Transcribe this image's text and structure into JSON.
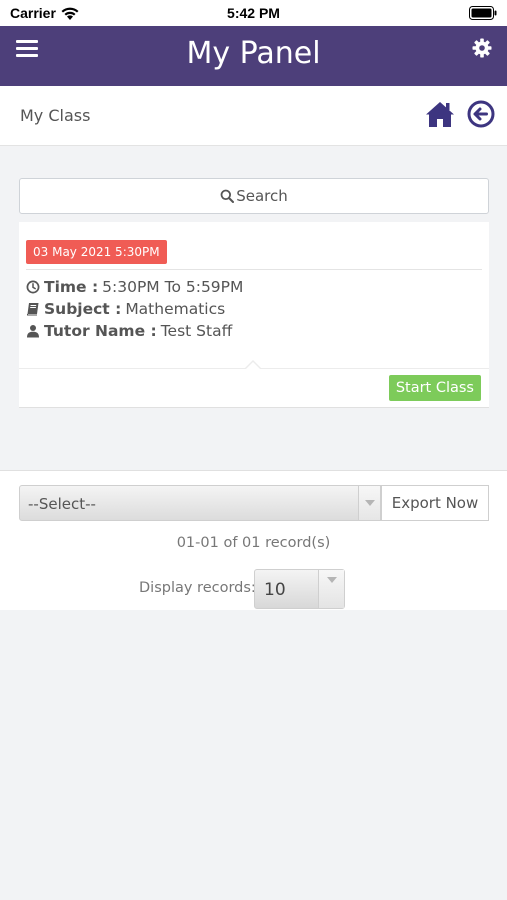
{
  "status_bar": {
    "carrier": "Carrier",
    "time": "5:42 PM"
  },
  "header": {
    "title": "My Panel"
  },
  "subheader": {
    "title": "My Class"
  },
  "search": {
    "label": "Search"
  },
  "class_card": {
    "date": "03 May 2021 5:30PM",
    "time_label": "Time :",
    "time_value": "5:30PM To 5:59PM",
    "subject_label": "Subject :",
    "subject_value": "Mathematics",
    "tutor_label": "Tutor Name :",
    "tutor_value": "Test Staff",
    "start_button": "Start Class"
  },
  "export": {
    "select_value": "--Select--",
    "export_button": "Export Now",
    "records": "01-01 of 01 record(s)",
    "display_label": "Display records:",
    "display_value": "10"
  },
  "colors": {
    "header_bg": "#4d3f7a",
    "badge": "#f05c55",
    "start_button": "#7dcb5a",
    "icon_accent": "#3d3580"
  },
  "icons": [
    "wifi-icon",
    "battery-icon",
    "menu-icon",
    "gear-icon",
    "home-icon",
    "back-arrow-icon",
    "search-icon",
    "clock-icon",
    "book-icon",
    "user-icon"
  ]
}
